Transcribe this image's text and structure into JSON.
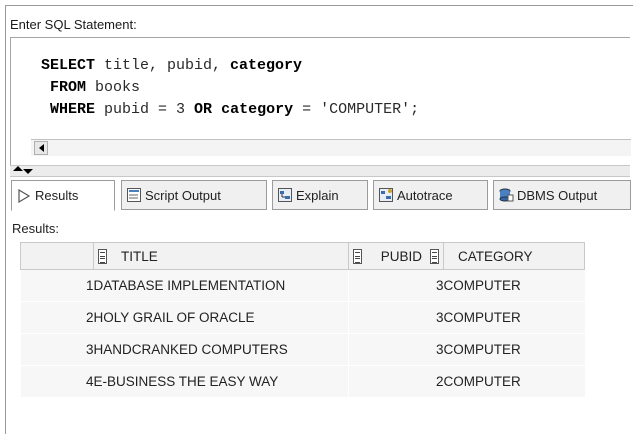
{
  "editor": {
    "label": "Enter SQL Statement:",
    "lines": [
      [
        {
          "t": "SELECT",
          "kw": true
        },
        {
          "t": " title, pubid, ",
          "kw": false
        },
        {
          "t": "category",
          "kw": true
        }
      ],
      [
        {
          "t": " FROM",
          "kw": true
        },
        {
          "t": " books",
          "kw": false
        }
      ],
      [
        {
          "t": " WHERE",
          "kw": true
        },
        {
          "t": " pubid = 3 ",
          "kw": false
        },
        {
          "t": "OR",
          "kw": true
        },
        {
          "t": " ",
          "kw": false
        },
        {
          "t": "category",
          "kw": true
        },
        {
          "t": " = 'COMPUTER';",
          "kw": false
        }
      ]
    ]
  },
  "tabs": [
    {
      "label": "Results",
      "icon": "run-arrow-icon",
      "active": true
    },
    {
      "label": "Script Output",
      "icon": "script-output-icon",
      "active": false
    },
    {
      "label": "Explain",
      "icon": "explain-icon",
      "active": false
    },
    {
      "label": "Autotrace",
      "icon": "autotrace-icon",
      "active": false
    },
    {
      "label": "DBMS Output",
      "icon": "dbms-output-icon",
      "active": false
    }
  ],
  "results": {
    "label": "Results:",
    "columns": [
      "TITLE",
      "PUBID",
      "CATEGORY"
    ],
    "rows": [
      {
        "num": "1",
        "title": "DATABASE IMPLEMENTATION",
        "pubid": "3",
        "category": "COMPUTER"
      },
      {
        "num": "2",
        "title": "HOLY GRAIL OF ORACLE",
        "pubid": "3",
        "category": "COMPUTER"
      },
      {
        "num": "3",
        "title": "HANDCRANKED COMPUTERS",
        "pubid": "3",
        "category": "COMPUTER"
      },
      {
        "num": "4",
        "title": "E-BUSINESS THE EASY WAY",
        "pubid": "2",
        "category": "COMPUTER"
      }
    ]
  }
}
